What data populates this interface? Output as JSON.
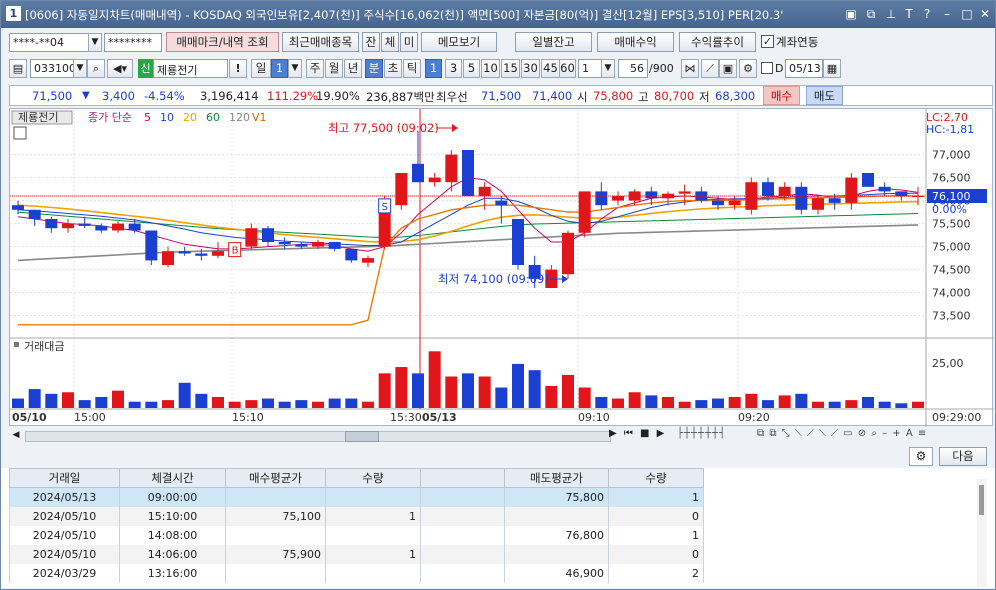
{
  "window": {
    "number": "1",
    "title": "[0606] 자동일지차트(매매내역) - KOSDAQ 외국인보유[2,407(천)] 주식수[16,062(천)] 액면[500] 자본금[80(억)] 결산[12월] EPS[3,510] PER[20.3'"
  },
  "toolbar1": {
    "account": "****-**04",
    "password": "********",
    "mark_btn": "매매마크/내역 조회",
    "recent_btn": "최근매매종목",
    "tab_jan": "잔",
    "tab_che": "체",
    "tab_mi": "미",
    "memo_btn": "메모보기",
    "daily_btn": "일별잔고",
    "profit_btn": "매매수익",
    "return_btn": "수익률추이",
    "account_link": "계좌연동",
    "account_link_checked": true
  },
  "toolbar2": {
    "code": "033100",
    "credit": "신",
    "stock_name": "제룡전기",
    "period_day": "일",
    "period_num": "1",
    "week": "주",
    "month": "월",
    "year": "년",
    "minute": "분",
    "second": "초",
    "tick": "틱",
    "intervals": [
      "1",
      "3",
      "5",
      "10",
      "15",
      "30",
      "45",
      "60"
    ],
    "active_interval": "1",
    "count_sel": "1",
    "count": "56",
    "count_total": "/900",
    "date": "05/13",
    "d_label": "D"
  },
  "quote": {
    "price": "71,500",
    "change": "3,400",
    "change_pct": "-4.54%",
    "volume": "3,196,414",
    "vol_ratio": "111.29%",
    "turnover": "19.90%",
    "amount": "236,887백만",
    "best_label": "최우선",
    "best_ask": "71,500",
    "best_bid": "71,400",
    "open_label": "시",
    "open": "75,800",
    "high_label": "고",
    "high": "80,700",
    "low_label": "저",
    "low": "68,300",
    "buy_btn": "매수",
    "sell_btn": "매도"
  },
  "chart": {
    "stock_label": "제룡전기",
    "ma_label": "종가 단순",
    "ma_periods": [
      "5",
      "10",
      "20",
      "60",
      "120"
    ],
    "ma_colors": [
      "#cc0066",
      "#1a3fd1",
      "#f0a000",
      "#0a8a3a",
      "#888888"
    ],
    "v1": "V1",
    "lc": "LC:2,70",
    "hc": "HC:-1,81",
    "high_ann": "최고 77,500 (09:02)",
    "low_ann": "최저 74,100 (09:09)",
    "price_tag": "76,100",
    "pct_tag": "0.00%",
    "y_labels": [
      "77,000",
      "76,500",
      "76,000",
      "75,500",
      "75,000",
      "74,500",
      "74,000",
      "73,500"
    ],
    "vol_title": "거래대금",
    "vol_label": "25,00",
    "x_labels": [
      "05/10",
      "15:00",
      "15:10",
      "15:30",
      "05/13",
      "09:10",
      "09:20",
      "09:29:00"
    ]
  },
  "chart_data": {
    "type": "candlestick",
    "ylim": [
      73100,
      77600
    ],
    "ticks": [
      77000,
      76500,
      76000,
      75500,
      75000,
      74500,
      74000,
      73500
    ],
    "candles": [
      [
        75900,
        76000,
        75700,
        75800
      ],
      [
        75800,
        75800,
        75450,
        75600
      ],
      [
        75600,
        75650,
        75300,
        75400
      ],
      [
        75400,
        75600,
        75300,
        75500
      ],
      [
        75500,
        75650,
        75400,
        75450
      ],
      [
        75450,
        75500,
        75300,
        75350
      ],
      [
        75350,
        75550,
        75300,
        75500
      ],
      [
        75500,
        75600,
        75300,
        75350
      ],
      [
        75350,
        75350,
        74600,
        74700
      ],
      [
        74600,
        75000,
        74550,
        74900
      ],
      [
        74900,
        75000,
        74800,
        74850
      ],
      [
        74850,
        74950,
        74700,
        74800
      ],
      [
        74800,
        75100,
        74750,
        74900
      ],
      [
        74900,
        75050,
        74850,
        75000
      ],
      [
        75000,
        75500,
        74950,
        75400
      ],
      [
        75400,
        75450,
        75000,
        75100
      ],
      [
        75100,
        75200,
        74950,
        75050
      ],
      [
        75050,
        75100,
        74950,
        75000
      ],
      [
        75000,
        75150,
        74950,
        75100
      ],
      [
        75100,
        75100,
        74900,
        74950
      ],
      [
        74950,
        74950,
        74650,
        74700
      ],
      [
        74650,
        74800,
        74550,
        74750
      ],
      [
        75000,
        76100,
        74950,
        76000
      ],
      [
        75900,
        76600,
        75800,
        76600
      ],
      [
        76800,
        77500,
        76400,
        76400
      ],
      [
        76400,
        76600,
        76300,
        76500
      ],
      [
        76400,
        77100,
        76200,
        77000
      ],
      [
        77100,
        77100,
        76100,
        76100
      ],
      [
        76100,
        76400,
        75800,
        76300
      ],
      [
        76000,
        76100,
        75500,
        75900
      ],
      [
        75600,
        75600,
        74500,
        74600
      ],
      [
        74600,
        74800,
        74100,
        74300
      ],
      [
        74100,
        74600,
        74100,
        74500
      ],
      [
        74400,
        75350,
        74300,
        75300
      ],
      [
        75300,
        76200,
        75200,
        76200
      ],
      [
        76200,
        76400,
        75800,
        75900
      ],
      [
        76000,
        76200,
        75900,
        76100
      ],
      [
        76000,
        76250,
        75900,
        76200
      ],
      [
        76200,
        76300,
        75900,
        76050
      ],
      [
        76050,
        76200,
        75900,
        76150
      ],
      [
        76150,
        76350,
        75900,
        76200
      ],
      [
        76200,
        76300,
        75950,
        76000
      ],
      [
        76000,
        76100,
        75800,
        75900
      ],
      [
        75900,
        76100,
        75800,
        76000
      ],
      [
        75800,
        76500,
        75700,
        76400
      ],
      [
        76400,
        76500,
        76000,
        76100
      ],
      [
        76100,
        76400,
        76000,
        76300
      ],
      [
        76300,
        76400,
        75700,
        75800
      ],
      [
        75800,
        76100,
        75700,
        76050
      ],
      [
        76050,
        76150,
        75800,
        75950
      ],
      [
        75950,
        76600,
        75800,
        76500
      ],
      [
        76600,
        76600,
        76300,
        76300
      ],
      [
        76300,
        76400,
        76100,
        76200
      ],
      [
        76200,
        76200,
        76000,
        76100
      ],
      [
        76100,
        76300,
        75900,
        76100
      ]
    ],
    "volume_amount": [
      6,
      12,
      9,
      10,
      5,
      7,
      11,
      4,
      4,
      5,
      16,
      9,
      7,
      4,
      5,
      6,
      4,
      5,
      4,
      6,
      6,
      4,
      22,
      26,
      22,
      36,
      20,
      22,
      20,
      13,
      28,
      24,
      14,
      21,
      13,
      7,
      6,
      10,
      8,
      7,
      4,
      5,
      6,
      7,
      9,
      5,
      8,
      9,
      4,
      4,
      5,
      7,
      4,
      3,
      4
    ],
    "ma": {
      "line1": [
        75650,
        75600,
        75550,
        75500,
        75480,
        75450,
        75400,
        75350,
        75250,
        75150,
        75050,
        75000,
        74950,
        74950,
        74970,
        75000,
        75020,
        75050,
        75050,
        75020,
        74950,
        74900,
        75000,
        75300,
        75700,
        76000,
        76300,
        76500,
        76450,
        76200,
        75800,
        75400,
        75100,
        75100,
        75300,
        75600,
        75850,
        75950,
        76050,
        76080,
        76100,
        76080,
        76050,
        76020,
        76030,
        76080,
        76100,
        76150,
        76120,
        76060,
        76100,
        76200,
        76260,
        76230,
        76180
      ],
      "line2": [
        75800,
        75780,
        75750,
        75720,
        75690,
        75660,
        75620,
        75580,
        75520,
        75450,
        75380,
        75300,
        75250,
        75200,
        75170,
        75150,
        75120,
        75100,
        75080,
        75060,
        75040,
        75020,
        75030,
        75100,
        75300,
        75500,
        75700,
        75900,
        76050,
        76050,
        75980,
        75850,
        75680,
        75550,
        75500,
        75550,
        75650,
        75750,
        75850,
        75920,
        75970,
        76010,
        76030,
        76040,
        76040,
        76050,
        76070,
        76090,
        76100,
        76100,
        76110,
        76130,
        76150,
        76160,
        76160
      ],
      "line3": [
        75900,
        75880,
        75850,
        75820,
        75780,
        75740,
        75700,
        75660,
        75620,
        75570,
        75520,
        75470,
        75420,
        75380,
        75340,
        75300,
        75260,
        75230,
        75200,
        75170,
        75140,
        75110,
        75100,
        75110,
        75150,
        75230,
        75330,
        75450,
        75560,
        75640,
        75680,
        75690,
        75670,
        75640,
        75620,
        75620,
        75640,
        75680,
        75720,
        75760,
        75790,
        75820,
        75840,
        75860,
        75870,
        75890,
        75900,
        75910,
        75920,
        75930,
        75940,
        75950,
        75960,
        75970,
        75980
      ],
      "line4": [
        75750,
        75720,
        75690,
        75660,
        75630,
        75600,
        75570,
        75540,
        75510,
        75480,
        75450,
        75420,
        75390,
        75370,
        75350,
        75330,
        75310,
        75290,
        75270,
        75250,
        75230,
        75210,
        75200,
        75210,
        75240,
        75280,
        75320,
        75360,
        75400,
        75440,
        75470,
        75490,
        75500,
        75510,
        75520,
        75530,
        75540,
        75550,
        75560,
        75570,
        75580,
        75590,
        75600,
        75610,
        75620,
        75630,
        75640,
        75650,
        75660,
        75670,
        75680,
        75690,
        75700,
        75710,
        75720
      ],
      "line5": [
        74700,
        74720,
        74740,
        74760,
        74780,
        74800,
        74820,
        74840,
        74860,
        74880,
        74890,
        74900,
        74910,
        74920,
        74930,
        74940,
        74950,
        74960,
        74970,
        74980,
        74990,
        75000,
        75010,
        75030,
        75050,
        75070,
        75090,
        75110,
        75130,
        75150,
        75170,
        75190,
        75210,
        75230,
        75250,
        75270,
        75290,
        75300,
        75310,
        75320,
        75330,
        75340,
        75350,
        75360,
        75370,
        75380,
        75390,
        75400,
        75410,
        75420,
        75430,
        75440,
        75450,
        75460,
        75470
      ],
      "orange_step": [
        73300,
        73300,
        73300,
        73300,
        73300,
        73300,
        73300,
        73300,
        73300,
        73300,
        73300,
        73300,
        73300,
        73300,
        73300,
        73300,
        73300,
        73300,
        73300,
        73300,
        73300,
        73400,
        75000,
        75400,
        75600,
        75700,
        75800,
        75850,
        75900,
        75900,
        75900,
        75850,
        75800,
        75750,
        75750,
        75800,
        75850,
        75900,
        75950,
        75980,
        76000,
        76000,
        76000,
        76010,
        76020,
        76030,
        76040,
        76050,
        76060,
        76070,
        76080,
        76090,
        76100,
        76100,
        76100
      ]
    }
  },
  "trade_table": {
    "headers": [
      "거래일",
      "체결시간",
      "매수평균가",
      "수량",
      "",
      "매도평균가",
      "수량"
    ],
    "rows": [
      {
        "date": "2024/05/13",
        "time": "09:00:00",
        "buy": "",
        "bqty": "",
        "sell": "75,800",
        "sqty": "1"
      },
      {
        "date": "2024/05/10",
        "time": "15:10:00",
        "buy": "75,100",
        "bqty": "1",
        "sell": "",
        "sqty": "0"
      },
      {
        "date": "2024/05/10",
        "time": "14:08:00",
        "buy": "",
        "bqty": "",
        "sell": "76,800",
        "sqty": "1"
      },
      {
        "date": "2024/05/10",
        "time": "14:06:00",
        "buy": "75,900",
        "bqty": "1",
        "sell": "",
        "sqty": "0"
      },
      {
        "date": "2024/03/29",
        "time": "13:16:00",
        "buy": "",
        "bqty": "",
        "sell": "46,900",
        "sqty": "2"
      }
    ]
  },
  "next_btn": "다음"
}
